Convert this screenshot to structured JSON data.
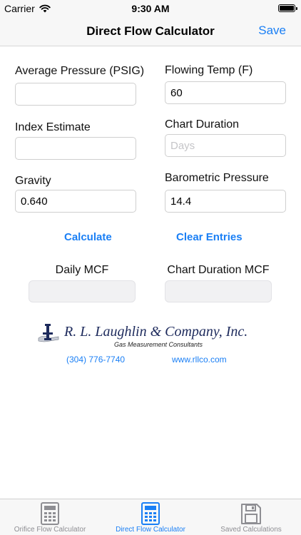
{
  "status": {
    "carrier": "Carrier",
    "time": "9:30 AM"
  },
  "nav": {
    "title": "Direct Flow Calculator",
    "save_label": "Save"
  },
  "form": {
    "average_pressure": {
      "label": "Average Pressure (PSIG)",
      "value": "",
      "placeholder": ""
    },
    "flowing_temp": {
      "label": "Flowing Temp (F)",
      "value": "60",
      "placeholder": ""
    },
    "index_estimate": {
      "label": "Index Estimate",
      "value": "",
      "placeholder": ""
    },
    "chart_duration": {
      "label": "Chart Duration",
      "value": "",
      "placeholder": "Days"
    },
    "gravity": {
      "label": "Gravity",
      "value": "0.640",
      "placeholder": ""
    },
    "barometric_pressure": {
      "label": "Barometric Pressure",
      "value": "14.4",
      "placeholder": ""
    }
  },
  "actions": {
    "calculate": "Calculate",
    "clear": "Clear Entries"
  },
  "results": {
    "daily_mcf": "Daily MCF",
    "chart_duration_mcf": "Chart Duration MCF"
  },
  "company": {
    "name": "R. L. Laughlin & Company, Inc.",
    "tagline": "Gas Measurement Consultants",
    "phone": "(304) 776-7740",
    "website": "www.rllco.com"
  },
  "tabs": [
    {
      "label": "Orifice Flow Calculator",
      "icon": "calculator-icon",
      "active": false
    },
    {
      "label": "Direct Flow Calculator",
      "icon": "calculator-icon",
      "active": true
    },
    {
      "label": "Saved Calculations",
      "icon": "floppy-disk-icon",
      "active": false
    }
  ],
  "colors": {
    "accent": "#1a7ff5",
    "inactive": "#8e8e93",
    "bar_bg": "#f7f7f7"
  }
}
